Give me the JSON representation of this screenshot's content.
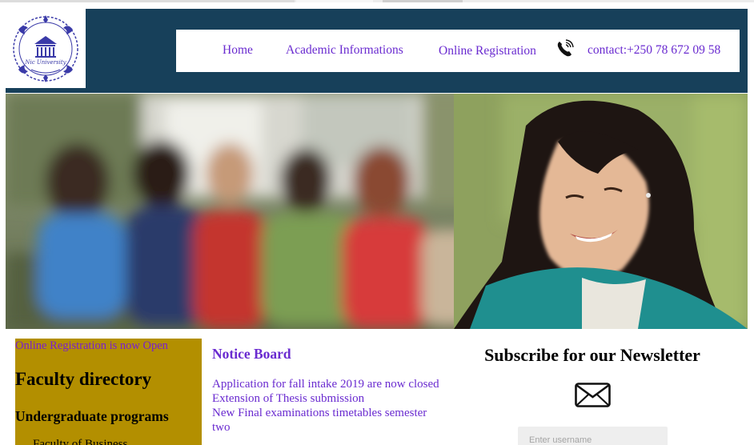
{
  "header": {
    "logo_text": "Nic University",
    "nav": {
      "home": "Home",
      "academic": "Academic Informations",
      "online_registration": "Online Registration",
      "phone_icon": "phone-icon",
      "contact": "contact:+250 78 672 09 58"
    }
  },
  "left_column": {
    "marquee": "Online Registration is now Open",
    "title": "Faculty directory",
    "subtitle": "Undergraduate programs",
    "items": [
      "Faculty of Business"
    ]
  },
  "notice_board": {
    "title": "Notice Board",
    "items": [
      "Application for fall intake 2019 are now closed",
      "Extension of Thesis submission",
      "New Final examinations timetables semester two"
    ]
  },
  "newsletter": {
    "title": "Subscribe for our Newsletter",
    "icon": "envelope-icon",
    "username_placeholder": "Enter username"
  },
  "colors": {
    "header_bg": "#17405a",
    "link": "#6a2bd0",
    "left_panel": "#b38f00",
    "input_bg": "#eeeeee"
  }
}
